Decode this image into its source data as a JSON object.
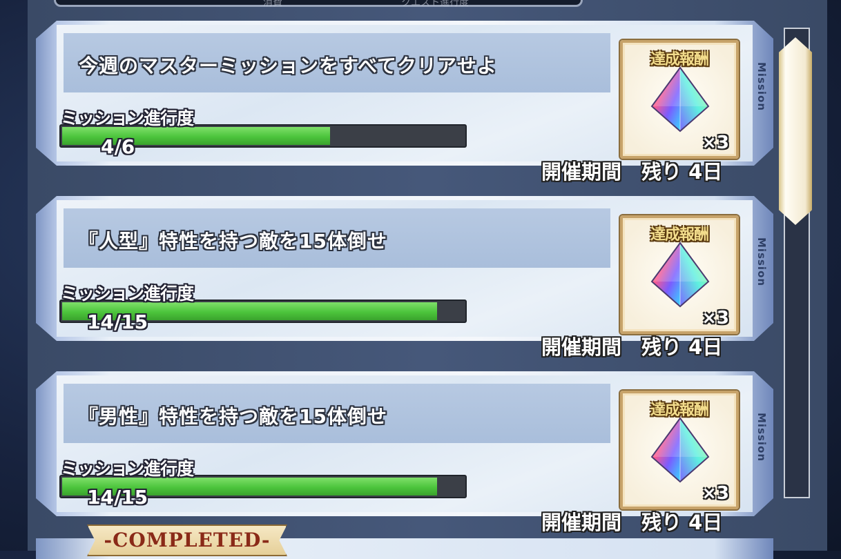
{
  "background_text": {
    "left": "消費",
    "right": "クエスト進行度"
  },
  "progress_label": "ミッション進行度",
  "vertical_label": "Mission",
  "missions": [
    {
      "title": "今週のマスターミッションをすべてクリアせよ",
      "progress_text": "4/6",
      "progress_fraction": 0.667,
      "reward_label": "達成報酬",
      "reward_count": "×3",
      "period": "開催期間　残り 4日"
    },
    {
      "title": "『人型』特性を持つ敵を15体倒せ",
      "progress_text": "14/15",
      "progress_fraction": 0.933,
      "reward_label": "達成報酬",
      "reward_count": "×3",
      "period": "開催期間　残り 4日"
    },
    {
      "title": "『男性』特性を持つ敵を15体倒せ",
      "progress_text": "14/15",
      "progress_fraction": 0.933,
      "reward_label": "達成報酬",
      "reward_count": "×3",
      "period": "開催期間　残り 4日"
    }
  ],
  "completed_label": "-COMPLETED-",
  "colors": {
    "bar_fill": "#4cc43c",
    "bar_track": "#3b3f47",
    "reward_frame": "#c7a36a"
  },
  "icons": {
    "reward": "saint-quartz-icon"
  }
}
